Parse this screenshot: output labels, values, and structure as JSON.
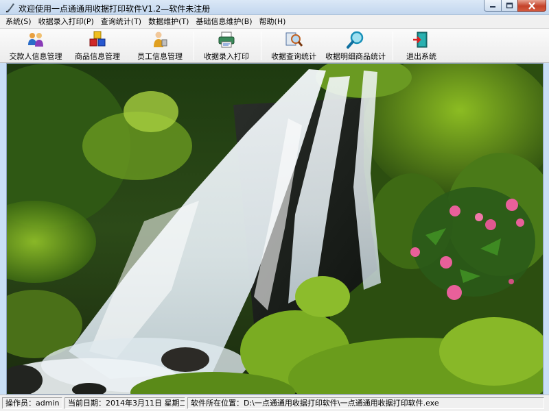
{
  "window": {
    "title": "欢迎使用一点通通用收据打印软件V1.2—软件未注册"
  },
  "menu": [
    {
      "label": "系统(S)"
    },
    {
      "label": "收据录入打印(P)"
    },
    {
      "label": "查询统计(T)"
    },
    {
      "label": "数据维护(T)"
    },
    {
      "label": "基础信息维护(B)"
    },
    {
      "label": "帮助(H)"
    }
  ],
  "toolbar": {
    "items": [
      {
        "label": "交款人信息管理",
        "icon": "people-icon"
      },
      {
        "label": "商品信息管理",
        "icon": "cubes-icon"
      },
      {
        "label": "员工信息管理",
        "icon": "employee-icon"
      },
      {
        "label": "收据录入打印",
        "icon": "print-icon"
      },
      {
        "label": "收据查询统计",
        "icon": "search-icon"
      },
      {
        "label": "收据明细商品统计",
        "icon": "magnifier-icon"
      },
      {
        "label": "退出系统",
        "icon": "exit-door-icon"
      }
    ]
  },
  "status": {
    "operator": "操作员：admin",
    "date": "当前日期：2014年3月11日 星期二",
    "path": "软件所在位置：D:\\一点通通用收据打印软件\\一点通通用收据打印软件.exe"
  },
  "colors": {
    "titlebar": "#c2d6ee",
    "close_button": "#c4432a",
    "menubar": "#f0f0f0",
    "toolbar": "#ececec"
  }
}
